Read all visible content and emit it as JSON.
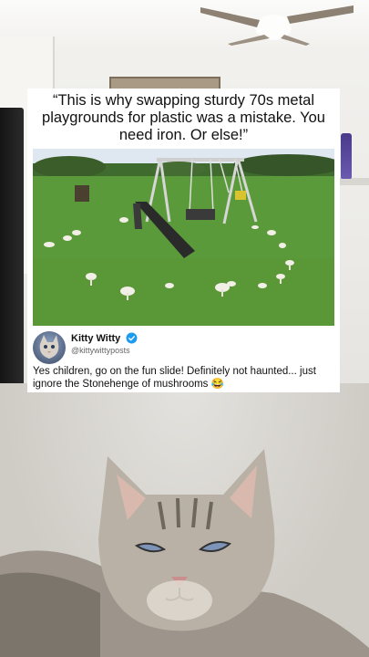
{
  "post": {
    "quote": "“This is why swapping sturdy 70s metal playgrounds for plastic was a mistake. You need iron. Or else!”",
    "author_name": "Kitty Witty",
    "author_handle": "@kittywittyposts",
    "tweet_text": "Yes children, go on the fun slide! Definitely not haunted... just ignore the Stonehenge of mushrooms 😂"
  },
  "colors": {
    "card_background": "#ffffff",
    "verified_badge": "#1d9bf0",
    "grass": "#5b9a3a",
    "sky": "#dfe8f0"
  },
  "icons": {
    "verified": "verified-badge-icon",
    "avatar": "cat-avatar"
  }
}
